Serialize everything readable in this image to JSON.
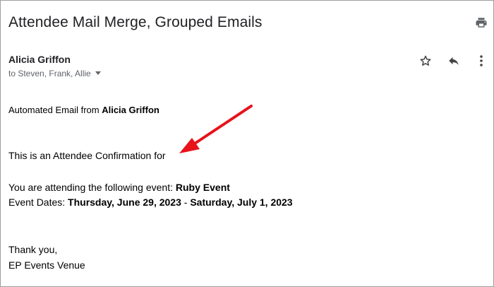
{
  "email": {
    "subject": "Attendee Mail Merge, Grouped Emails",
    "sender": "Alicia Griffon",
    "recipients": "to Steven, Frank, Allie"
  },
  "icons": {
    "print": "print-icon",
    "star": "star-icon",
    "reply": "reply-icon",
    "more": "more-vert-icon"
  },
  "body": {
    "intro_prefix": "Automated Email from ",
    "intro_name": "Alicia Griffon",
    "confirmation": "This is an Attendee Confirmation for",
    "event_prefix": "You are attending the following event: ",
    "event_name": "Ruby Event",
    "dates_prefix": "Event Dates: ",
    "start_date": "Thursday, June 29, 2023",
    "date_separator": " - ",
    "end_date": "Saturday, July 1, 2023",
    "closing": "Thank you,",
    "signature": "EP Events Venue"
  },
  "colors": {
    "annotation_arrow": "#e8121b"
  }
}
